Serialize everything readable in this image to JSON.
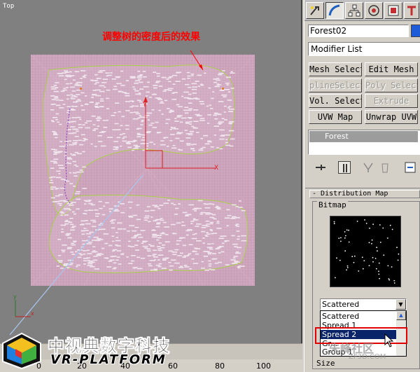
{
  "viewport": {
    "label": "Top",
    "annotation": "调整树的密度后的效果",
    "gizmo_x": "X",
    "gizmo_y": "Y",
    "axis_x": "x",
    "axis_y": "y"
  },
  "timeline": {
    "ticks": [
      "20",
      "40",
      "60",
      "80",
      "100"
    ],
    "start": "0"
  },
  "logo": {
    "cn": "中视典数字科技",
    "en": "VR-PLATFORM"
  },
  "panel": {
    "tabs": [
      "create-icon",
      "modify-icon",
      "hierarchy-icon",
      "motion-icon",
      "display-icon",
      "utilities-icon"
    ],
    "object_name": "Forest02",
    "color": "#1e5bd7",
    "modifier_list": "Modifier List",
    "modifier_buttons": [
      {
        "label": "Mesh Select",
        "enabled": true
      },
      {
        "label": "Edit Mesh",
        "enabled": true
      },
      {
        "label": "plineSelect",
        "enabled": false
      },
      {
        "label": "Poly Select",
        "enabled": false
      },
      {
        "label": "Vol. Select",
        "enabled": true
      },
      {
        "label": "Extrude",
        "enabled": false
      },
      {
        "label": "UVW Map",
        "enabled": true
      },
      {
        "label": "Unwrap UVW",
        "enabled": true
      }
    ],
    "stack_item": "Forest"
  },
  "distribution": {
    "rollout_title": "Distribution Map",
    "group_label": "Bitmap",
    "dropdown_value": "Scattered",
    "options": [
      "Scattered",
      "Spread 1",
      "Spread 2",
      "Gr...",
      "Group 1"
    ],
    "selected_index": 2,
    "size_label": "Size"
  },
  "watermark": {
    "main": "朱峰社区",
    "sub": "ZF3D.COM"
  }
}
